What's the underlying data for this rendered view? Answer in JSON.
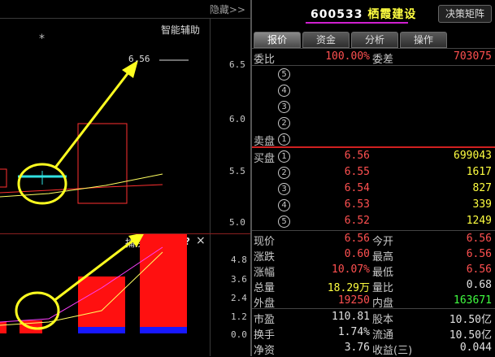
{
  "chart_area": {
    "hide_label": "隐藏>>",
    "assist_label": "智能辅助",
    "star": "*",
    "price_marker": "6.56",
    "upper_axis": [
      "6.5",
      "6.0",
      "5.5",
      "5.0"
    ],
    "lower_title": "捕捞季节",
    "lower_axis": [
      "4.8",
      "3.6",
      "2.4",
      "1.2",
      "0.0"
    ],
    "question": "?",
    "close": "×"
  },
  "header": {
    "code": "600533",
    "name": "栖霞建设",
    "decision_button": "决策矩阵"
  },
  "tabs": [
    "报价",
    "资金",
    "分析",
    "操作"
  ],
  "order_book": {
    "weibi_label": "委比",
    "weibi_value": "100.00%",
    "weicha_label": "委差",
    "weicha_value": "703075",
    "sell_label": "卖盘",
    "buy_label": "买盘",
    "sell_levels": [
      "5",
      "4",
      "3",
      "2",
      "1"
    ],
    "buy": [
      {
        "level": "1",
        "price": "6.56",
        "vol": "699043"
      },
      {
        "level": "2",
        "price": "6.55",
        "vol": "1617"
      },
      {
        "level": "3",
        "price": "6.54",
        "vol": "827"
      },
      {
        "level": "4",
        "price": "6.53",
        "vol": "339"
      },
      {
        "level": "5",
        "price": "6.52",
        "vol": "1249"
      }
    ]
  },
  "stats": [
    {
      "l1": "现价",
      "v1": "6.56",
      "l2": "今开",
      "v2": "6.56"
    },
    {
      "l1": "涨跌",
      "v1": "0.60",
      "l2": "最高",
      "v2": "6.56"
    },
    {
      "l1": "涨幅",
      "v1": "10.07%",
      "l2": "最低",
      "v2": "6.56"
    },
    {
      "l1": "总量",
      "v1": "18.29万",
      "l2": "量比",
      "v2": "0.68"
    },
    {
      "l1": "外盘",
      "v1": "19250",
      "l2": "内盘",
      "v2": "163671"
    },
    {
      "l1": "市盈",
      "v1": "110.81",
      "l2": "股本",
      "v2": "10.50亿"
    },
    {
      "l1": "换手",
      "v1": "1.74%",
      "l2": "流通",
      "v2": "10.50亿"
    },
    {
      "l1": "净资",
      "v1": "3.76",
      "l2": "收益(三)",
      "v2": "0.044"
    }
  ]
}
